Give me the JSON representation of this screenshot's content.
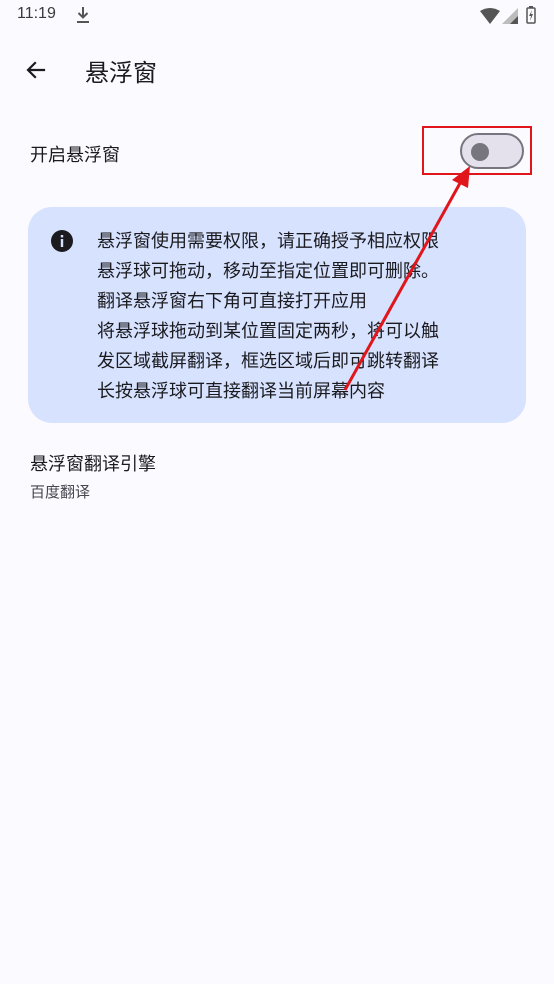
{
  "status_bar": {
    "time": "11:19",
    "icons": [
      "download-icon",
      "wifi-icon",
      "signal-icon",
      "battery-icon"
    ]
  },
  "app_bar": {
    "back_icon": "arrow-back-icon",
    "title": "悬浮窗"
  },
  "floating_window_setting": {
    "label": "开启悬浮窗",
    "enabled": false
  },
  "info_card": {
    "icon": "info-icon",
    "lines": [
      "悬浮窗使用需要权限，请正确授予相应权限",
      "悬浮球可拖动，移动至指定位置即可删除。",
      "翻译悬浮窗右下角可直接打开应用",
      "将悬浮球拖动到某位置固定两秒，将可以触",
      "发区域截屏翻译，框选区域后即可跳转翻译",
      "长按悬浮球可直接翻译当前屏幕内容"
    ]
  },
  "engine_setting": {
    "title": "悬浮窗翻译引擎",
    "value": "百度翻译"
  },
  "colors": {
    "background": "#fbfaff",
    "card": "#d7e2ff",
    "annotation": "#e0161b"
  }
}
